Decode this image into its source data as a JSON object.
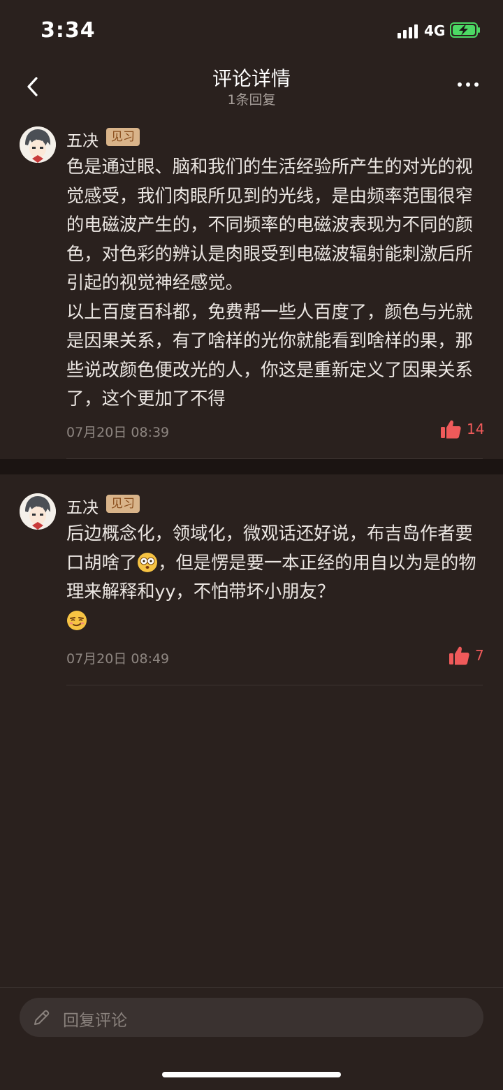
{
  "status_bar": {
    "time": "3:34",
    "network": "4G"
  },
  "header": {
    "title": "评论详情",
    "subtitle": "1条回复"
  },
  "comments": [
    {
      "username": "五决",
      "badge": "见习",
      "text": "色是通过眼、脑和我们的生活经验所产生的对光的视觉感受，我们肉眼所见到的光线，是由频率范围很窄的电磁波产生的，不同频率的电磁波表现为不同的颜色，对色彩的辨认是肉眼受到电磁波辐射能刺激后所引起的视觉神经感觉。\n以上百度百科都，免费帮一些人百度了，颜色与光就是因果关系，有了啥样的光你就能看到啥样的果，那些说改颜色便改光的人，你这是重新定义了因果关系了，这个更加了不得",
      "timestamp": "07月20日 08:39",
      "likes": "14"
    },
    {
      "username": "五决",
      "badge": "见习",
      "text_part1": "后边概念化，领域化，微观话还好说，布吉岛作者要口胡啥了",
      "text_part2": "，但是愣是要一本正经的用自以为是的物理来解释和yy，不怕带坏小朋友？",
      "timestamp": "07月20日 08:49",
      "likes": "7"
    }
  ],
  "reply": {
    "placeholder": "回复评论"
  },
  "icons": {
    "back": "chevron-left-icon",
    "more": "more-dots-icon",
    "like": "thumbs-up-icon",
    "edit": "pencil-icon",
    "emoji_1": "shocked-face-emoji",
    "emoji_2": "smirk-face-emoji"
  },
  "colors": {
    "background": "#2a211e",
    "like": "#ef5a5a",
    "badge_bg": "#d9b48a",
    "badge_text": "#8a4e1d"
  }
}
